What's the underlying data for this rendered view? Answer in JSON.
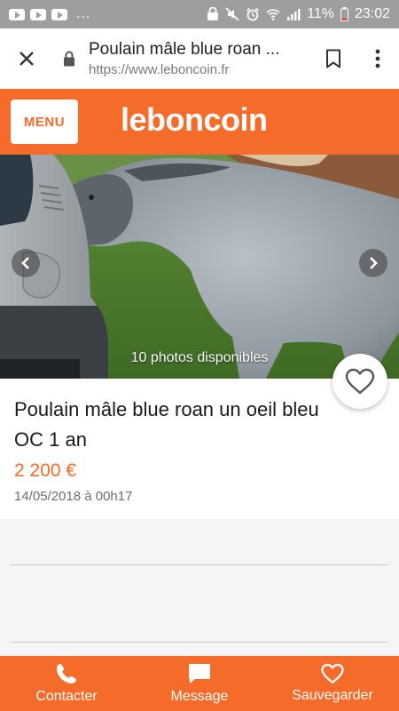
{
  "status_bar": {
    "dots": "...",
    "battery": "11%",
    "time": "23:02",
    "icons": [
      "youtube-icon",
      "youtube-icon",
      "youtube-icon",
      "face-lock-icon",
      "mute-icon",
      "alarm-icon",
      "wifi-icon",
      "signal-icon",
      "battery-icon"
    ]
  },
  "browser": {
    "page_title": "Poulain mâle blue roan ...",
    "domain": "https://www.leboncoin.fr",
    "icons": [
      "close-icon",
      "lock-icon",
      "bookmark-icon",
      "overflow-menu-icon"
    ]
  },
  "header": {
    "menu_label": "MENU",
    "logo_text": "leboncoin"
  },
  "photo": {
    "caption": "10 photos disponibles"
  },
  "ad": {
    "title": "Poulain mâle blue roan un oeil bleu OC 1 an",
    "price": "2 200 €",
    "date": "14/05/2018 à 00h17"
  },
  "bottom_bar": {
    "items": [
      {
        "label": "Contacter",
        "icon": "phone-icon"
      },
      {
        "label": "Message",
        "icon": "message-icon"
      },
      {
        "label": "Sauvegarder",
        "icon": "heart-icon"
      }
    ]
  },
  "colors": {
    "accent": "#f56b2a",
    "status_bar": "#9e9e9e"
  }
}
